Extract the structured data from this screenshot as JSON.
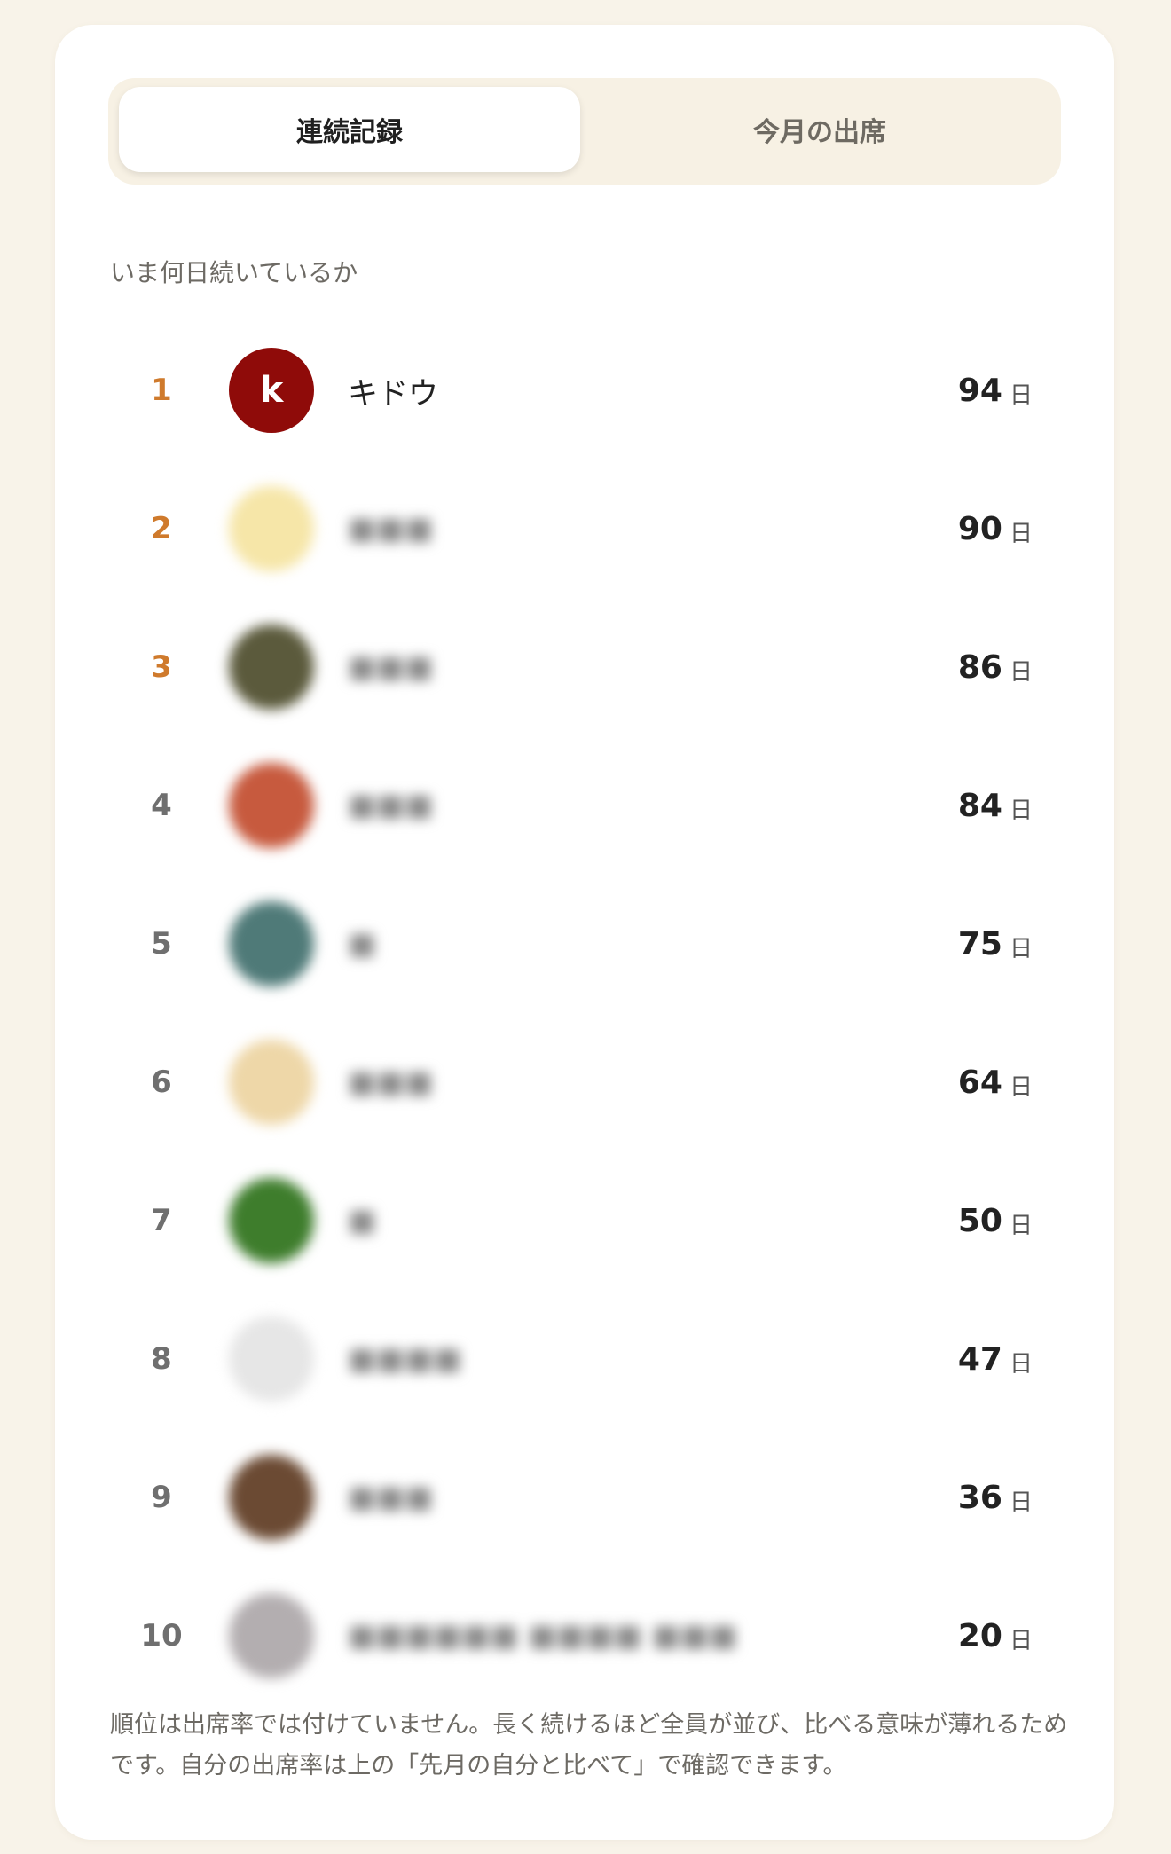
{
  "tabs": [
    {
      "label": "連続記録",
      "active": true
    },
    {
      "label": "今月の出席",
      "active": false
    }
  ],
  "subtitle": "いま何日続いているか",
  "day_unit": "日",
  "ranking": [
    {
      "rank": "1",
      "name": "キドウ",
      "avatar_letter": "k",
      "days": "94",
      "top": true
    },
    {
      "rank": "2",
      "days": "90",
      "top": true,
      "avatar_color": "#f6e6a8"
    },
    {
      "rank": "3",
      "days": "86",
      "top": true,
      "avatar_color": "#5b5a3c"
    },
    {
      "rank": "4",
      "days": "84",
      "avatar_color": "#c75a3e"
    },
    {
      "rank": "5",
      "days": "75",
      "avatar_color": "#4f7a78"
    },
    {
      "rank": "6",
      "days": "64",
      "avatar_color": "#eed7a8"
    },
    {
      "rank": "7",
      "days": "50",
      "avatar_color": "#3e7d2c"
    },
    {
      "rank": "8",
      "days": "47",
      "avatar_color": "#e6e6e6"
    },
    {
      "rank": "9",
      "days": "36",
      "avatar_color": "#6b4a33"
    },
    {
      "rank": "10",
      "days": "20",
      "avatar_color": "#b3aeb0"
    }
  ],
  "note": "順位は出席率では付けていません。長く続けるほど全員が並び、比べる意味が薄れるためです。自分の出席率は上の「先月の自分と比べて」で確認できます。",
  "colors": {
    "accent_rank": "#cf7a2c",
    "avatar_letter_bg": "#8f0b09",
    "page_bg": "#f8f3e9"
  }
}
